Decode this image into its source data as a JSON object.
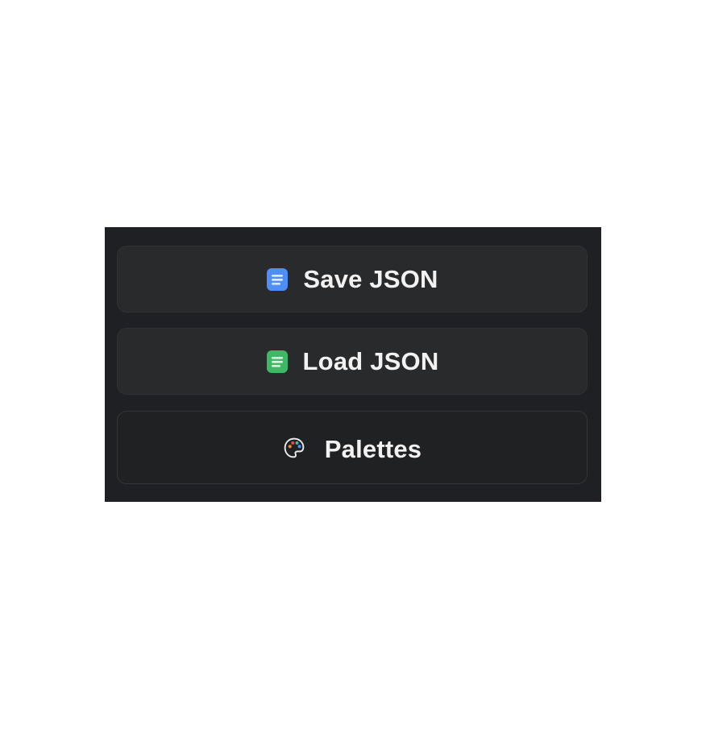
{
  "panel": {
    "buttons": [
      {
        "label": "Save JSON",
        "icon": "document-icon",
        "icon_color": "#4f8ef7"
      },
      {
        "label": "Load JSON",
        "icon": "document-icon",
        "icon_color": "#3fb866"
      },
      {
        "label": "Palettes",
        "icon": "palette-icon"
      }
    ]
  },
  "colors": {
    "panel_background": "#1f2023",
    "button_background": "#292a2c",
    "text": "#f2f2f2"
  }
}
